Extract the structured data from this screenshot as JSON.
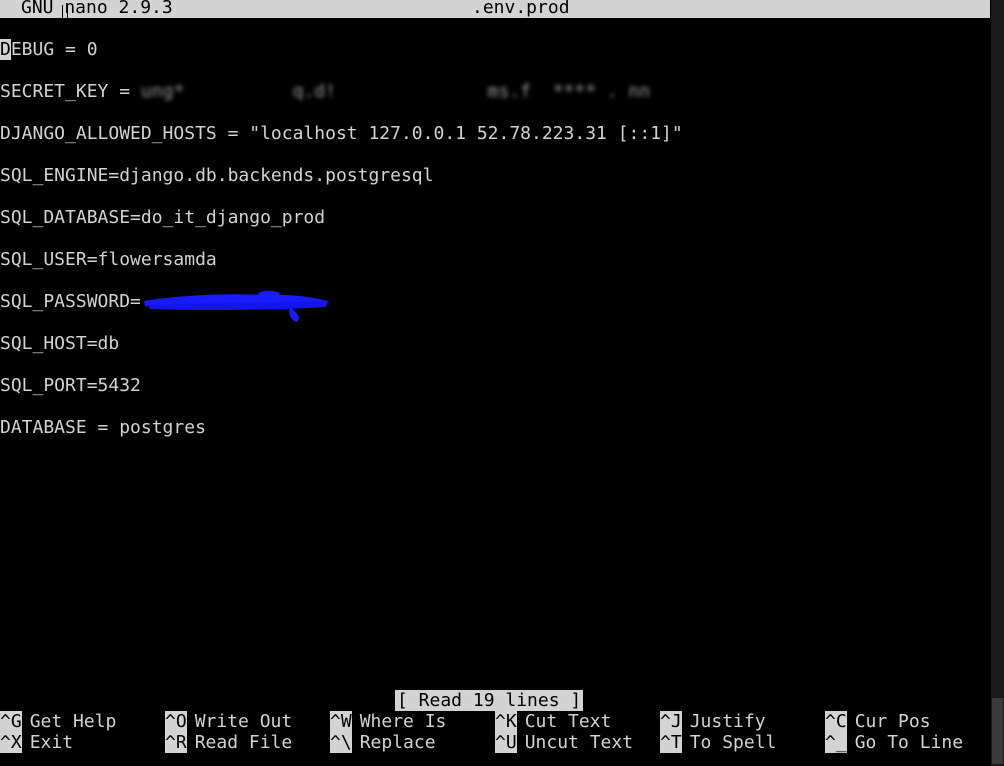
{
  "titlebar": {
    "app": "GNU nano 2.9.3",
    "filename": ".env.prod"
  },
  "editor": {
    "lines": [
      {
        "first_char": "D",
        "rest": "EBUG = 0"
      },
      {
        "text": "SECRET_KEY = ",
        "masked_text": "ung*          q.d!              ms.f  **** . nn"
      },
      {
        "text": "DJANGO_ALLOWED_HOSTS = \"localhost 127.0.0.1 52.78.223.31 [::1]\""
      },
      {
        "text": "SQL_ENGINE=django.db.backends.postgresql"
      },
      {
        "text": "SQL_DATABASE=do_it_django_prod"
      },
      {
        "text": "SQL_USER=flowersamda"
      },
      {
        "text": "SQL_PASSWORD="
      },
      {
        "text": "SQL_HOST=db"
      },
      {
        "text": "SQL_PORT=5432"
      },
      {
        "text": "DATABASE = postgres"
      }
    ]
  },
  "status_message": "[ Read 19 lines ]",
  "shortcuts": {
    "get_help": {
      "key": "^G",
      "label": "Get Help"
    },
    "write_out": {
      "key": "^O",
      "label": "Write Out"
    },
    "where_is": {
      "key": "^W",
      "label": "Where Is"
    },
    "cut_text": {
      "key": "^K",
      "label": "Cut Text"
    },
    "justify": {
      "key": "^J",
      "label": "Justify"
    },
    "cur_pos": {
      "key": "^C",
      "label": "Cur Pos"
    },
    "exit": {
      "key": "^X",
      "label": "Exit"
    },
    "read_file": {
      "key": "^R",
      "label": "Read File"
    },
    "replace": {
      "key": "^\\",
      "label": "Replace"
    },
    "uncut_text": {
      "key": "^U",
      "label": "Uncut Text"
    },
    "to_spell": {
      "key": "^T",
      "label": "To Spell"
    },
    "go_to_line": {
      "key": "^_",
      "label": "Go To Line"
    }
  },
  "colors": {
    "background": "#000000",
    "foreground": "#d3d3d3",
    "redaction": "#1a1aff"
  }
}
